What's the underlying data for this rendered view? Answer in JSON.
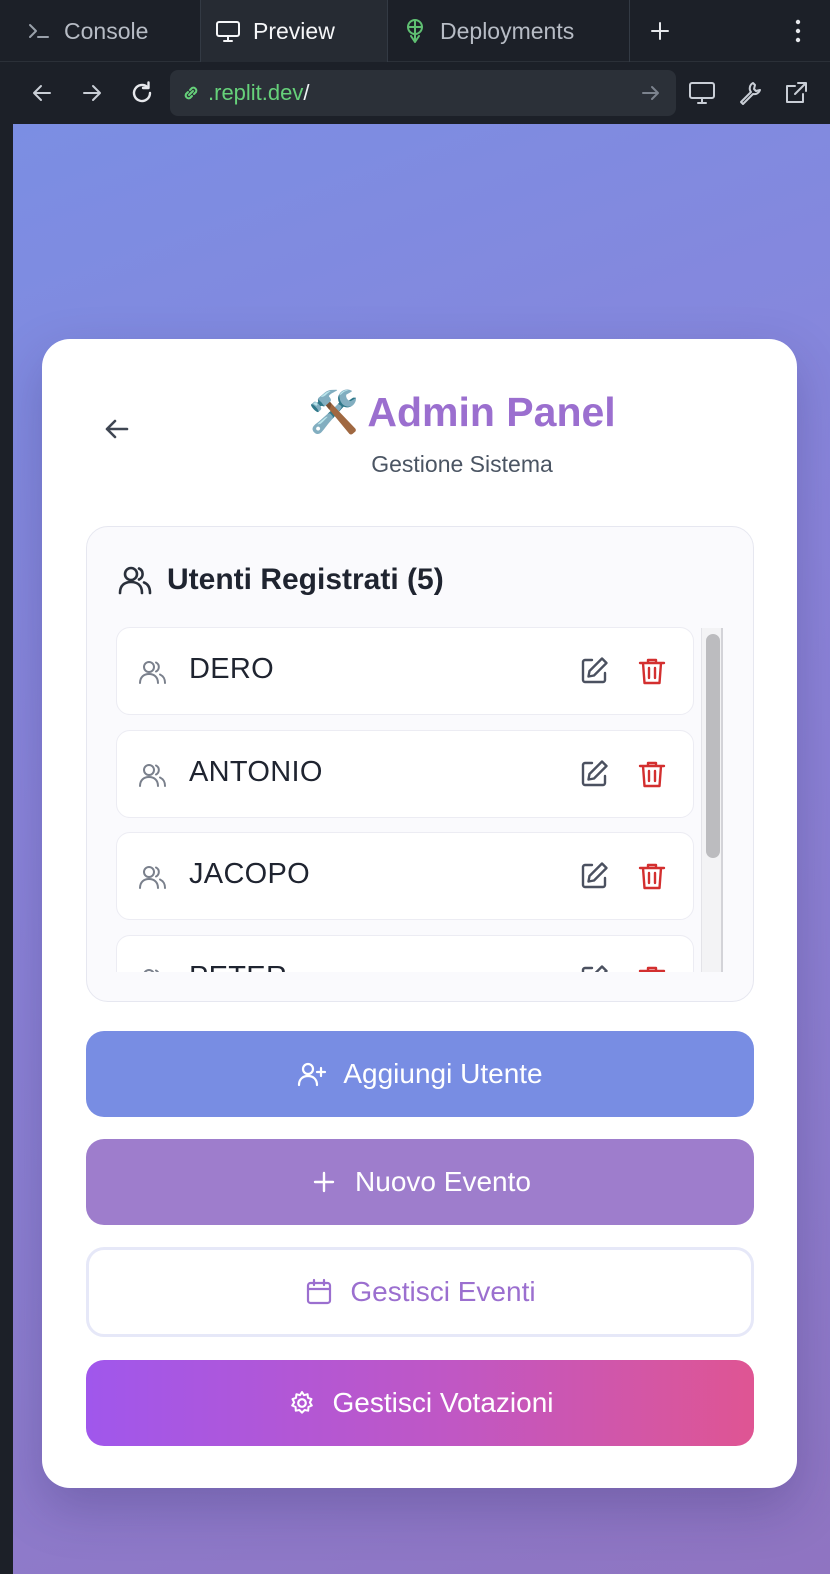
{
  "tabs": {
    "console_label": "Console",
    "preview_label": "Preview",
    "deployments_label": "Deployments"
  },
  "urlbar": {
    "domain": ".replit.dev",
    "path": "/"
  },
  "app": {
    "title_emoji": "🛠️",
    "title": "Admin Panel",
    "subtitle": "Gestione Sistema"
  },
  "users": {
    "heading": "Utenti Registrati (5)",
    "items": [
      {
        "name": "DERO"
      },
      {
        "name": "ANTONIO"
      },
      {
        "name": "JACOPO"
      },
      {
        "name": "PETER"
      }
    ]
  },
  "actions": {
    "add_user": "Aggiungi Utente",
    "new_event": "Nuovo Evento",
    "manage_events": "Gestisci Eventi",
    "manage_votes": "Gestisci Votazioni"
  },
  "colors": {
    "accent_purple": "#9b6fcf",
    "add_user_bg": "#788de3",
    "new_event_bg": "#9e7dcc",
    "delete_red": "#d32f2f",
    "url_green": "#66d17a"
  }
}
